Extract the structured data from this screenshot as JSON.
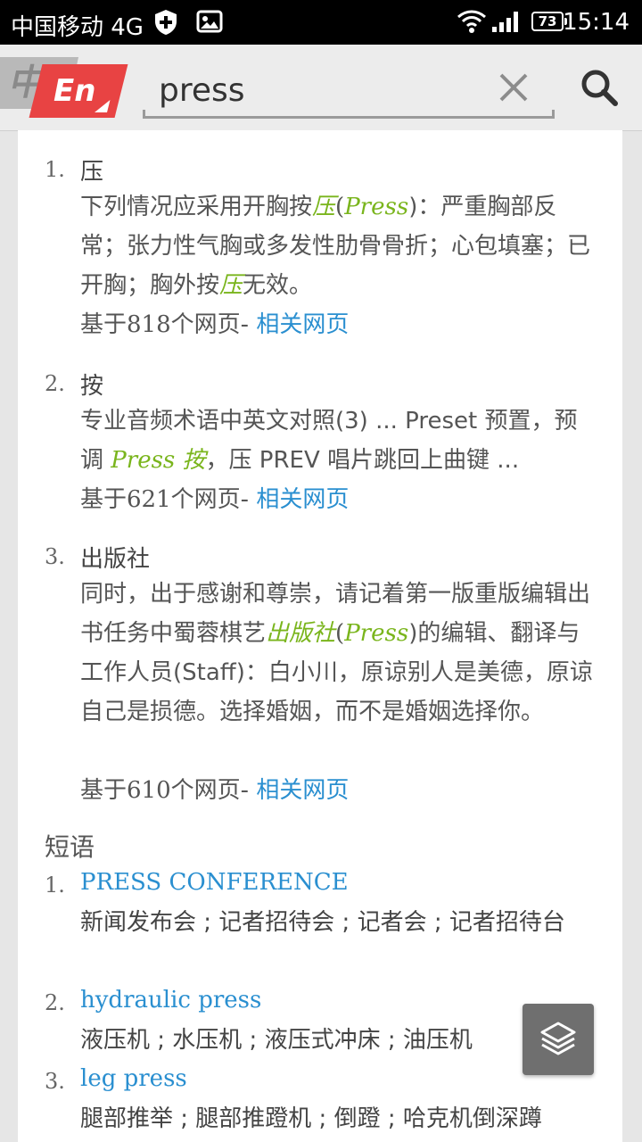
{
  "status_bar": {
    "carrier": "中国移动 4G",
    "battery": "73",
    "time": "15:14"
  },
  "header": {
    "lang_back": "中",
    "lang_front": "En",
    "search_value": "press"
  },
  "definitions": [
    {
      "num": "1.",
      "head": "压",
      "body_parts": [
        "下列情况应采用开胸按",
        "压",
        "(",
        "Press",
        ")：严重胸部反常；张力性气胸或多发性肋骨骨折；心包填塞；已开胸；胸外按",
        "压",
        "无效。"
      ],
      "meta_prefix": "基于",
      "meta_count": "818",
      "meta_suffix": "个网页-",
      "link": "相关网页"
    },
    {
      "num": "2.",
      "head": "按",
      "body_parts": [
        "专业音频术语中英文对照(3) ... Preset 预置，预调 ",
        "Press 按",
        "，压 PREV 唱片跳回上曲键 ..."
      ],
      "meta_prefix": "基于",
      "meta_count": "621",
      "meta_suffix": "个网页-",
      "link": "相关网页"
    },
    {
      "num": "3.",
      "head": "出版社",
      "body_parts": [
        "同时，出于感谢和尊崇，请记着第一版重版编辑出书任务中蜀蓉棋艺",
        "出版社",
        "(",
        "Press",
        ")的编辑、翻译与工作人员(Staff)：白小川，原谅别人是美德，原谅自己是损德。选择婚姻，而不是婚姻选择你。"
      ],
      "meta_prefix": "基于",
      "meta_count": "610",
      "meta_suffix": "个网页-",
      "link": "相关网页"
    }
  ],
  "phrases_title": "短语",
  "phrases": [
    {
      "num": "1.",
      "term": "PRESS CONFERENCE",
      "def": "新闻发布会 ; 记者招待会 ; 记者会 ; 记者招待台"
    },
    {
      "num": "2.",
      "term": "hydraulic press",
      "def": "液压机 ; 水压机 ; 液压式冲床 ; 油压机"
    },
    {
      "num": "3.",
      "term": "leg press",
      "def": "腿部推举 ; 腿部推蹬机 ; 倒蹬 ; 哈克机倒深蹲"
    }
  ],
  "colors": {
    "highlight": "#7ab51d",
    "link": "#2a8fd0",
    "lang_badge": "#e84343",
    "fab": "#6f6f6f"
  },
  "icons": {
    "clear": "close-icon",
    "search": "search-icon",
    "fab": "layers-icon"
  }
}
